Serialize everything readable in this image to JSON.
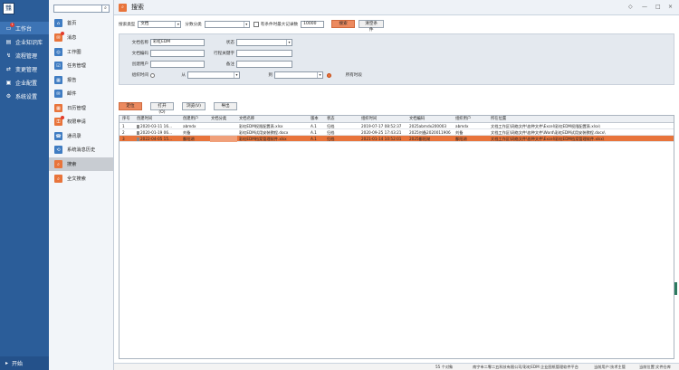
{
  "colors": {
    "nav_bg": "#2b5d99",
    "accent": "#e8743b",
    "badge": "#e23b2c"
  },
  "logo": {
    "text": "纳科文档"
  },
  "leftnav": {
    "items": [
      {
        "label": "工作台",
        "icon": "desktop-icon",
        "badge": "1",
        "active": true
      },
      {
        "label": "企业知识库",
        "icon": "folder-icon"
      },
      {
        "label": "流程管理",
        "icon": "flow-icon"
      },
      {
        "label": "变更管理",
        "icon": "change-icon"
      },
      {
        "label": "企业配置",
        "icon": "config-icon"
      },
      {
        "label": "系统设置",
        "icon": "gear-icon"
      }
    ],
    "footer": "开始"
  },
  "subnav": {
    "search_placeholder": "",
    "items": [
      {
        "label": "首页",
        "icon": "home-icon",
        "color": "#3f7cc2"
      },
      {
        "label": "消息",
        "icon": "message-icon",
        "color": "#e8743b",
        "badge": true
      },
      {
        "label": "工作圈",
        "icon": "circle-icon",
        "color": "#3f7cc2"
      },
      {
        "label": "任务管理",
        "icon": "task-icon",
        "color": "#3f7cc2"
      },
      {
        "label": "报告",
        "icon": "report-icon",
        "color": "#3f7cc2"
      },
      {
        "label": "邮件",
        "icon": "mail-icon",
        "color": "#3f7cc2"
      },
      {
        "label": "日历管理",
        "icon": "calendar-icon",
        "color": "#e8743b"
      },
      {
        "label": "权限申请",
        "icon": "permission-icon",
        "color": "#e8743b",
        "badge": true
      },
      {
        "label": "通讯录",
        "icon": "contacts-icon",
        "color": "#3f7cc2"
      },
      {
        "label": "系统消息历史",
        "icon": "history-icon",
        "color": "#3f7cc2"
      },
      {
        "label": "搜索",
        "icon": "search-icon",
        "color": "#e8743b",
        "active": true
      },
      {
        "label": "全文搜索",
        "icon": "fulltext-search-icon",
        "color": "#e8743b"
      }
    ]
  },
  "window": {
    "title": "搜索",
    "controls": [
      "◇",
      "—",
      "□",
      "×"
    ]
  },
  "filter": {
    "type_label": "搜索类型",
    "type_value": "文档",
    "category_label": "分数分类",
    "category_value": "",
    "checkbox_label": "有条件时最大记录数",
    "max_records": "10000",
    "search_button": "搜索",
    "clear_button": "清空条件"
  },
  "fields": {
    "doc_name_label": "文档名称",
    "doc_name_value": "彩虹EDM",
    "status_label": "状态",
    "doc_code_label": "文档编码",
    "keyword_label": "行程关键字",
    "creator_label": "创建用户",
    "remark_label": "备注",
    "time_label": "组织时间",
    "from_label": "从",
    "to_label": "到",
    "all_time_label": "所有时段"
  },
  "actions": {
    "locate": "定位",
    "open": "打开(O)",
    "browse": "浏览(V)",
    "export": "导出"
  },
  "table": {
    "columns": [
      "序号",
      "创建时间",
      "创建用户",
      "文档分类",
      "文档名称",
      "版本",
      "状态",
      "组织时间",
      "文档编码",
      "组织用户",
      "所在位置"
    ],
    "rows": [
      [
        "1",
        "2020-03-11 16...",
        "abmdx",
        "",
        "彩虹EDM权限配置表.xlsx",
        "A.1",
        "归档",
        "2019-07-17 08:52:37",
        "2025abmdx200003",
        "abmdx",
        "文档工作区\\网络文件\\各种文件\\Excel\\彩虹EDM权限配置表.xlsx\\"
      ],
      [
        "2",
        "2020-01-19 06...",
        "刘备",
        "",
        "彩虹EDM试用安装教程.docx",
        "A.1",
        "归档",
        "2020-09-25 17:43:21",
        "2025刘备2020011906",
        "刘备",
        "文档工作区\\网络文件\\各种文件\\Word\\彩虹EDM试用安装教程.docx\\"
      ],
      [
        "3",
        "2022-04-05 15...",
        "鄱阳湖",
        "",
        "彩虹EDM档案管理软件.xlsx",
        "A.1",
        "归档",
        "2021-01-14 10:52:01",
        "2025鄱阳湖",
        "鄱阳湖",
        "文档工作区\\网络文件\\各种文件\\Excel\\彩虹EDM档案管理软件.xlsx\\"
      ]
    ],
    "selected_row": 2
  },
  "status": {
    "count": "55 个对象",
    "company": "南宁市二零二五科技有限公司/彩虹EDM 企业图纸管理软件平台",
    "user": "当前用户:技术主管",
    "location": "当前位置:文件仓库"
  }
}
